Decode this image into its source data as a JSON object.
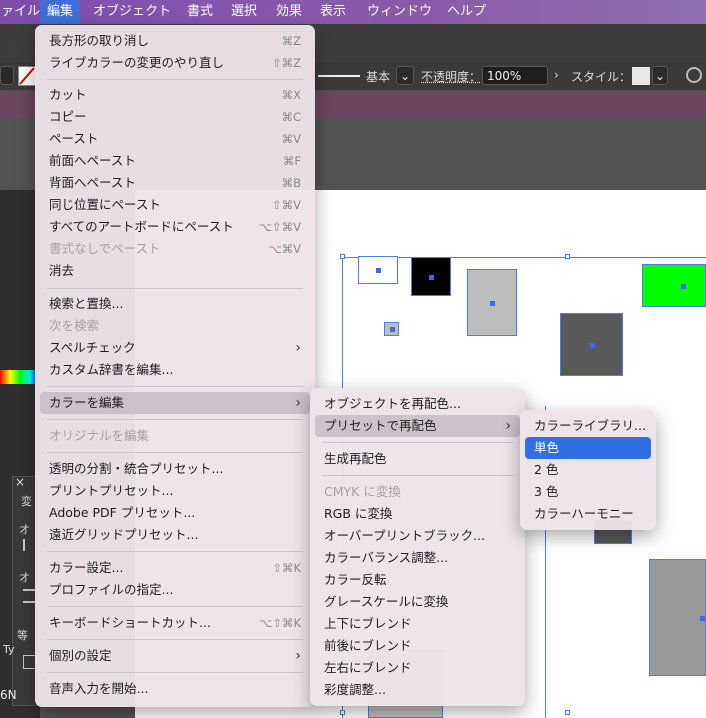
{
  "menubar": {
    "items": [
      "ァイル",
      "編集",
      "オブジェクト",
      "書式",
      "選択",
      "効果",
      "表示",
      "ウィンドウ",
      "ヘルプ"
    ]
  },
  "controlbar": {
    "stroke_label": "基本",
    "opacity_label": "不透明度：",
    "opacity_value": "100%",
    "style_label": "スタイル："
  },
  "edit_menu": {
    "items": [
      {
        "label": "長方形の取り消し",
        "shortcut": "⌘Z"
      },
      {
        "label": "ライブカラーの変更のやり直し",
        "shortcut": "⇧⌘Z"
      },
      {
        "label": "カット",
        "shortcut": "⌘X"
      },
      {
        "label": "コピー",
        "shortcut": "⌘C"
      },
      {
        "label": "ペースト",
        "shortcut": "⌘V"
      },
      {
        "label": "前面へペースト",
        "shortcut": "⌘F"
      },
      {
        "label": "背面へペースト",
        "shortcut": "⌘B"
      },
      {
        "label": "同じ位置にペースト",
        "shortcut": "⇧⌘V"
      },
      {
        "label": "すべてのアートボードにペースト",
        "shortcut": "⌥⇧⌘V"
      },
      {
        "label": "書式なしでペースト",
        "shortcut": "⌥⌘V"
      },
      {
        "label": "消去",
        "shortcut": ""
      },
      {
        "label": "検索と置換...",
        "shortcut": ""
      },
      {
        "label": "次を検索",
        "shortcut": ""
      },
      {
        "label": "スペルチェック",
        "shortcut": ""
      },
      {
        "label": "カスタム辞書を編集...",
        "shortcut": ""
      },
      {
        "label": "カラーを編集",
        "shortcut": ""
      },
      {
        "label": "オリジナルを編集",
        "shortcut": ""
      },
      {
        "label": "透明の分割・統合プリセット...",
        "shortcut": ""
      },
      {
        "label": "プリントプリセット...",
        "shortcut": ""
      },
      {
        "label": "Adobe PDF プリセット...",
        "shortcut": ""
      },
      {
        "label": "遠近グリッドプリセット...",
        "shortcut": ""
      },
      {
        "label": "カラー設定...",
        "shortcut": "⇧⌘K"
      },
      {
        "label": "プロファイルの指定...",
        "shortcut": ""
      },
      {
        "label": "キーボードショートカット...",
        "shortcut": "⌥⇧⌘K"
      },
      {
        "label": "個別の設定",
        "shortcut": ""
      },
      {
        "label": "音声入力を開始...",
        "shortcut": ""
      }
    ]
  },
  "color_menu": {
    "items": [
      "オブジェクトを再配色...",
      "プリセットで再配色",
      "生成再配色",
      "CMYK に変換",
      "RGB に変換",
      "オーバープリントブラック...",
      "カラーバランス調整...",
      "カラー反転",
      "グレースケールに変換",
      "上下にブレンド",
      "前後にブレンド",
      "左右にブレンド",
      "彩度調整..."
    ]
  },
  "preset_menu": {
    "items": [
      "カラーライブラリ...",
      "単色",
      "2 色",
      "3 色",
      "カラーハーモニー"
    ]
  },
  "left_panel": {
    "close": "×",
    "tab_char": "変",
    "label_o1": "オ",
    "label_o2": "オ",
    "label_equal": "等",
    "label_ty": "Ty",
    "label_6n": "6N"
  },
  "colors": {
    "menubar": "#8656ae",
    "highlight": "#2f6fe3",
    "green_shape": "#00ff00",
    "dark_shape": "#595959",
    "gray_shape": "#bdbdbd",
    "selection": "#4a7cf0"
  }
}
